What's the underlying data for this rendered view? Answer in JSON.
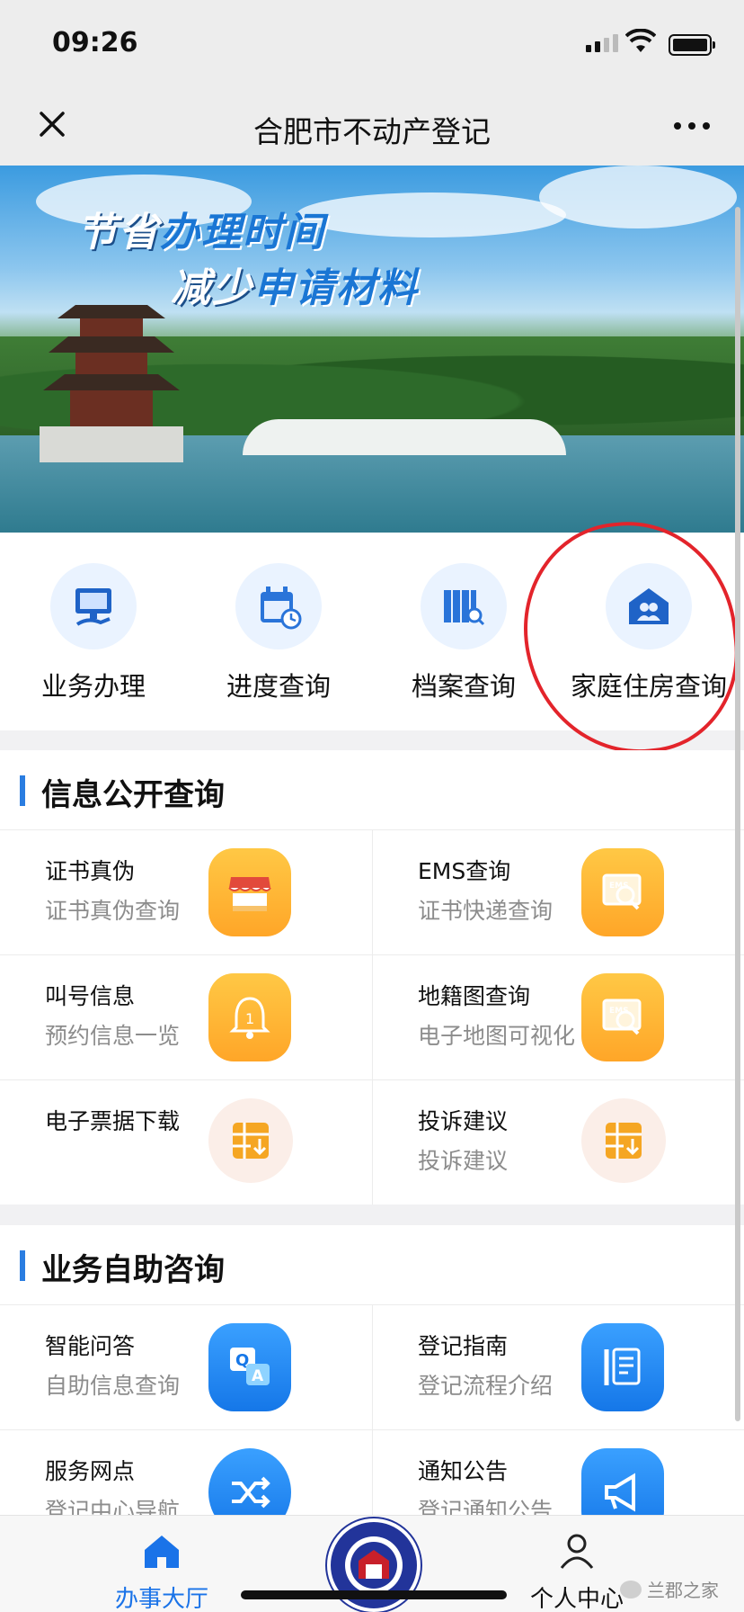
{
  "status_bar": {
    "time": "09:26"
  },
  "nav": {
    "title": "合肥市不动产登记"
  },
  "banner": {
    "slogan_line1_a": "节省",
    "slogan_line1_b": "办理时间",
    "slogan_line2_a": "减少",
    "slogan_line2_b": "申请材料"
  },
  "quick_menu": [
    {
      "label": "业务办理",
      "icon": "monitor-hand-icon"
    },
    {
      "label": "进度查询",
      "icon": "calendar-clock-icon"
    },
    {
      "label": "档案查询",
      "icon": "archive-search-icon"
    },
    {
      "label": "家庭住房查询",
      "icon": "house-family-icon"
    }
  ],
  "sections": [
    {
      "title": "信息公开查询",
      "items": [
        {
          "title": "证书真伪",
          "subtitle": "证书真伪查询",
          "icon": "shop-icon",
          "icon_style": "orange"
        },
        {
          "title": "EMS查询",
          "subtitle": "证书快递查询",
          "icon": "ems-search-icon",
          "icon_style": "orange"
        },
        {
          "title": "叫号信息",
          "subtitle": "预约信息一览",
          "icon": "bell-icon",
          "icon_style": "orange"
        },
        {
          "title": "地籍图查询",
          "subtitle": "电子地图可视化",
          "icon": "ems-search-icon",
          "icon_style": "orange"
        },
        {
          "title": "电子票据下载",
          "subtitle": "",
          "icon": "grid-download-icon",
          "icon_style": "pale"
        },
        {
          "title": "投诉建议",
          "subtitle": "投诉建议",
          "icon": "grid-download-icon",
          "icon_style": "pale"
        }
      ]
    },
    {
      "title": "业务自助咨询",
      "items": [
        {
          "title": "智能问答",
          "subtitle": "自助信息查询",
          "icon": "qa-icon",
          "icon_style": "blue"
        },
        {
          "title": "登记指南",
          "subtitle": "登记流程介绍",
          "icon": "guide-icon",
          "icon_style": "blue"
        },
        {
          "title": "服务网点",
          "subtitle": "登记中心导航",
          "icon": "shuffle-icon",
          "icon_style": "blue"
        },
        {
          "title": "通知公告",
          "subtitle": "登记通知公告",
          "icon": "megaphone-icon",
          "icon_style": "blue"
        }
      ]
    }
  ],
  "tabbar": {
    "home_label": "办事大厅",
    "profile_label": "个人中心"
  },
  "watermark": "兰郡之家",
  "colors": {
    "accent": "#1a73e8",
    "section_bar": "#2a7de1",
    "annotation_circle": "#e3242b"
  }
}
